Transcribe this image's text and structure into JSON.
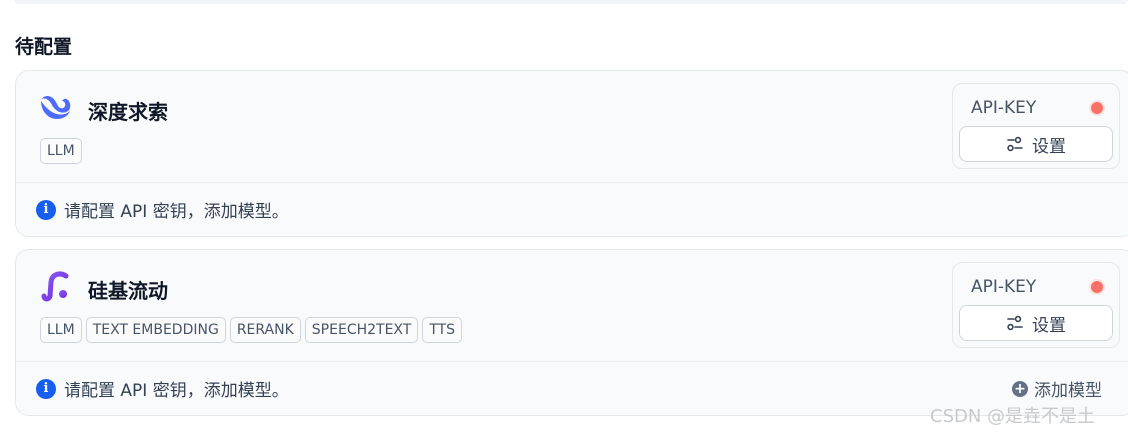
{
  "section_title": "待配置",
  "providers": [
    {
      "name": "深度求索",
      "tags": [
        "LLM"
      ],
      "apikey_label": "API-KEY",
      "settings_label": "设置",
      "info_text": "请配置 API 密钥，添加模型。",
      "logo_icon": "deepseek-whale-icon",
      "logo_color": "#4d6bfe",
      "status_color": "#f97066"
    },
    {
      "name": "硅基流动",
      "tags": [
        "LLM",
        "TEXT EMBEDDING",
        "RERANK",
        "SPEECH2TEXT",
        "TTS"
      ],
      "apikey_label": "API-KEY",
      "settings_label": "设置",
      "info_text": "请配置 API 密钥，添加模型。",
      "add_model_label": "添加模型",
      "logo_icon": "siliconflow-icon",
      "logo_color": "#7c3aed",
      "status_color": "#f97066"
    }
  ],
  "watermark": "CSDN @是垚不是土"
}
